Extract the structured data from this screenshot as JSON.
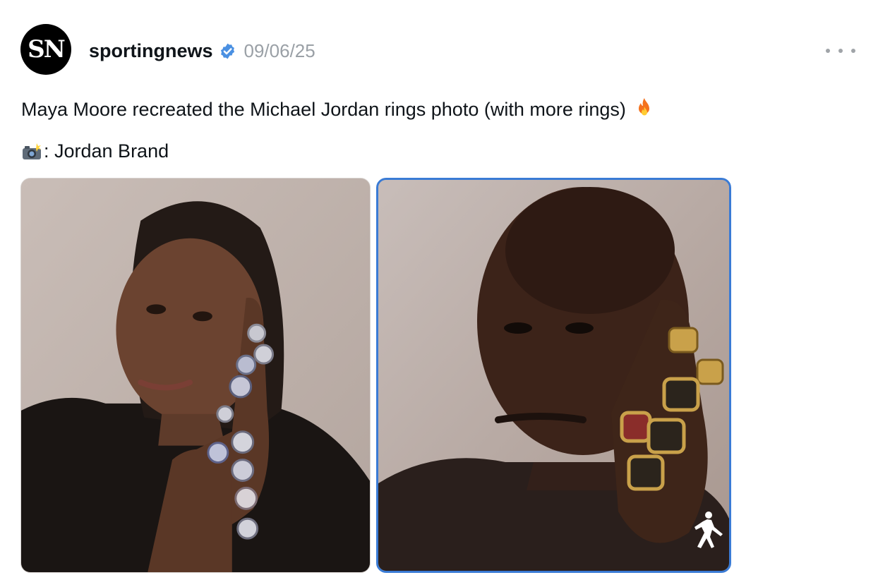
{
  "post": {
    "avatar_text": "SN",
    "username": "sportingnews",
    "verified_icon": "verified-check-icon",
    "date": "09/06/25",
    "more_icon": "more-options-icon",
    "caption_line1": "Maya Moore recreated the Michael Jordan rings photo (with more rings)",
    "caption_line1_emoji": "fire-emoji",
    "caption_line2_emoji": "camera-flash-emoji",
    "caption_line2": ": Jordan Brand"
  },
  "media": [
    {
      "subject": "woman with braided hair showing championship rings on her fingers"
    },
    {
      "subject": "man with shaved head showing championship rings on his fingers"
    }
  ],
  "colors": {
    "verified": "#4a90e2",
    "date_grey": "#9aa0a6",
    "selected_border": "#3a7bd5",
    "avatar_bg": "#000000"
  }
}
